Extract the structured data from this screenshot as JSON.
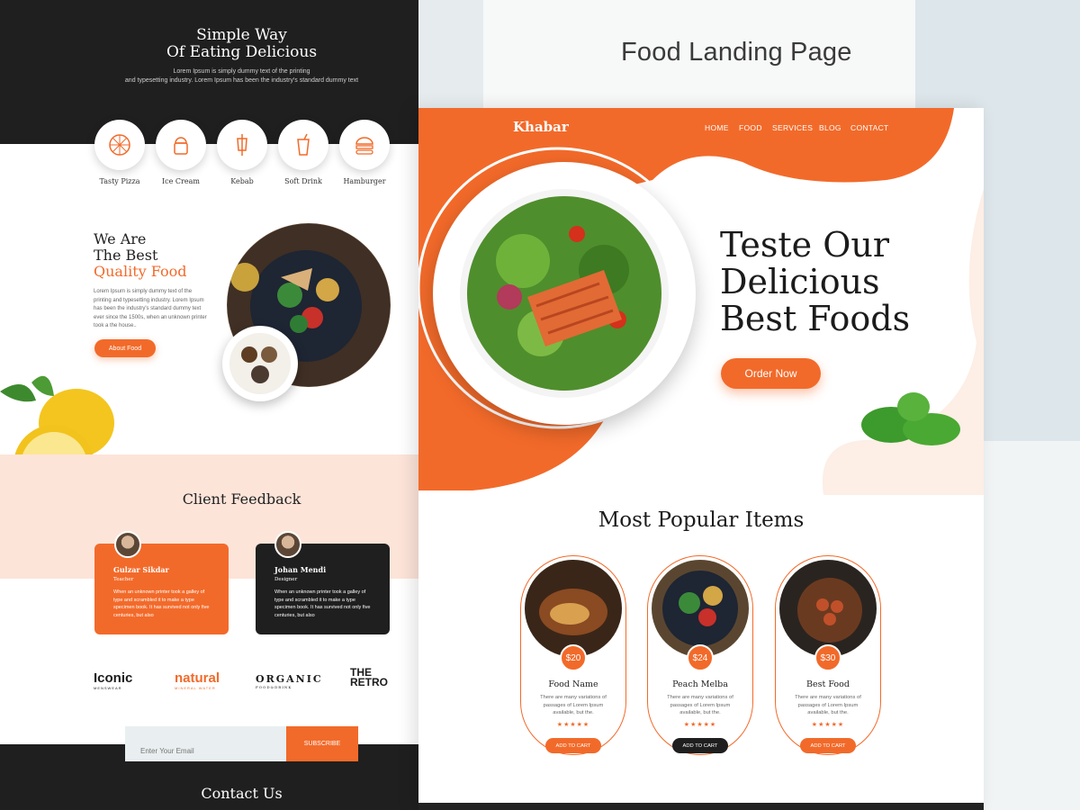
{
  "showcase": {
    "title": "Food Landing Page"
  },
  "left_page": {
    "hero": {
      "title_line1": "Simple Way",
      "title_line2": "Of Eating Delicious",
      "text_line1": "Lorem Ipsum is simply dummy text of the printing",
      "text_line2": "and typesetting industry. Lorem Ipsum has been the industry's standard dummy text"
    },
    "categories": [
      {
        "label": "Tasty Pizza",
        "icon": "pizza-icon"
      },
      {
        "label": "Ice Cream",
        "icon": "ice-cream-icon"
      },
      {
        "label": "Kebab",
        "icon": "kebab-icon"
      },
      {
        "label": "Soft Drink",
        "icon": "soft-drink-icon"
      },
      {
        "label": "Hamburger",
        "icon": "hamburger-icon"
      }
    ],
    "about": {
      "line1": "We Are",
      "line2": "The Best",
      "line3": "Quality Food",
      "text": "Lorem Ipsum is simply dummy text of the printing and typesetting industry. Lorem Ipsum has been the industry's standard dummy text ever since the 1500s, when an unknown printer took a the house..",
      "button": "About Food"
    },
    "feedback": {
      "title": "Client Feedback",
      "cards": [
        {
          "name": "Gulzar Sikdar",
          "role": "Teacher",
          "text": "When an unknown printer took a galley of type and scrambled it to make a type specimen book. It has survived not only five centuries, but also"
        },
        {
          "name": "Johan Mendi",
          "role": "Designer",
          "text": "When an unknown printer took a galley of type and scrambled it to make a type specimen book. It has survived not only five centuries, but also"
        }
      ]
    },
    "brands": [
      {
        "name": "Iconic",
        "sub": "MENSWEAR"
      },
      {
        "name": "natural",
        "sub": "MINERAL WATER"
      },
      {
        "name": "ORGANIC",
        "sub": "FOOD&DRINK"
      },
      {
        "name": "THE RETRO",
        "sub": ""
      }
    ],
    "newsletter": {
      "placeholder": "Enter Your Email",
      "button": "SUBSCRIBE"
    },
    "contact": {
      "title": "Contact Us"
    }
  },
  "right_page": {
    "logo": "Khabar",
    "nav": [
      "HOME",
      "FOOD",
      "SERVICES",
      "BLOG",
      "CONTACT"
    ],
    "hero": {
      "line1": "Teste Our",
      "line2": "Delicious",
      "line3": "Best Foods",
      "button": "Order Now"
    },
    "popular": {
      "title": "Most Popular Items",
      "items": [
        {
          "price": "$20",
          "name": "Food Name",
          "text": "There are many variations of passages of Lorem Ipsum available, but the.",
          "stars": "★★★★★",
          "button": "ADD TO CART"
        },
        {
          "price": "$24",
          "name": "Peach Melba",
          "text": "There are many variations of passages of Lorem Ipsum available, but the.",
          "stars": "★★★★★",
          "button": "ADD TO CART"
        },
        {
          "price": "$30",
          "name": "Best Food",
          "text": "There are many variations of passages of Lorem Ipsum available, but the.",
          "stars": "★★★★★",
          "button": "ADD TO CART"
        }
      ]
    }
  },
  "colors": {
    "accent": "#f26a2a",
    "dark": "#1f1f1f",
    "peach": "#fde4d9"
  }
}
